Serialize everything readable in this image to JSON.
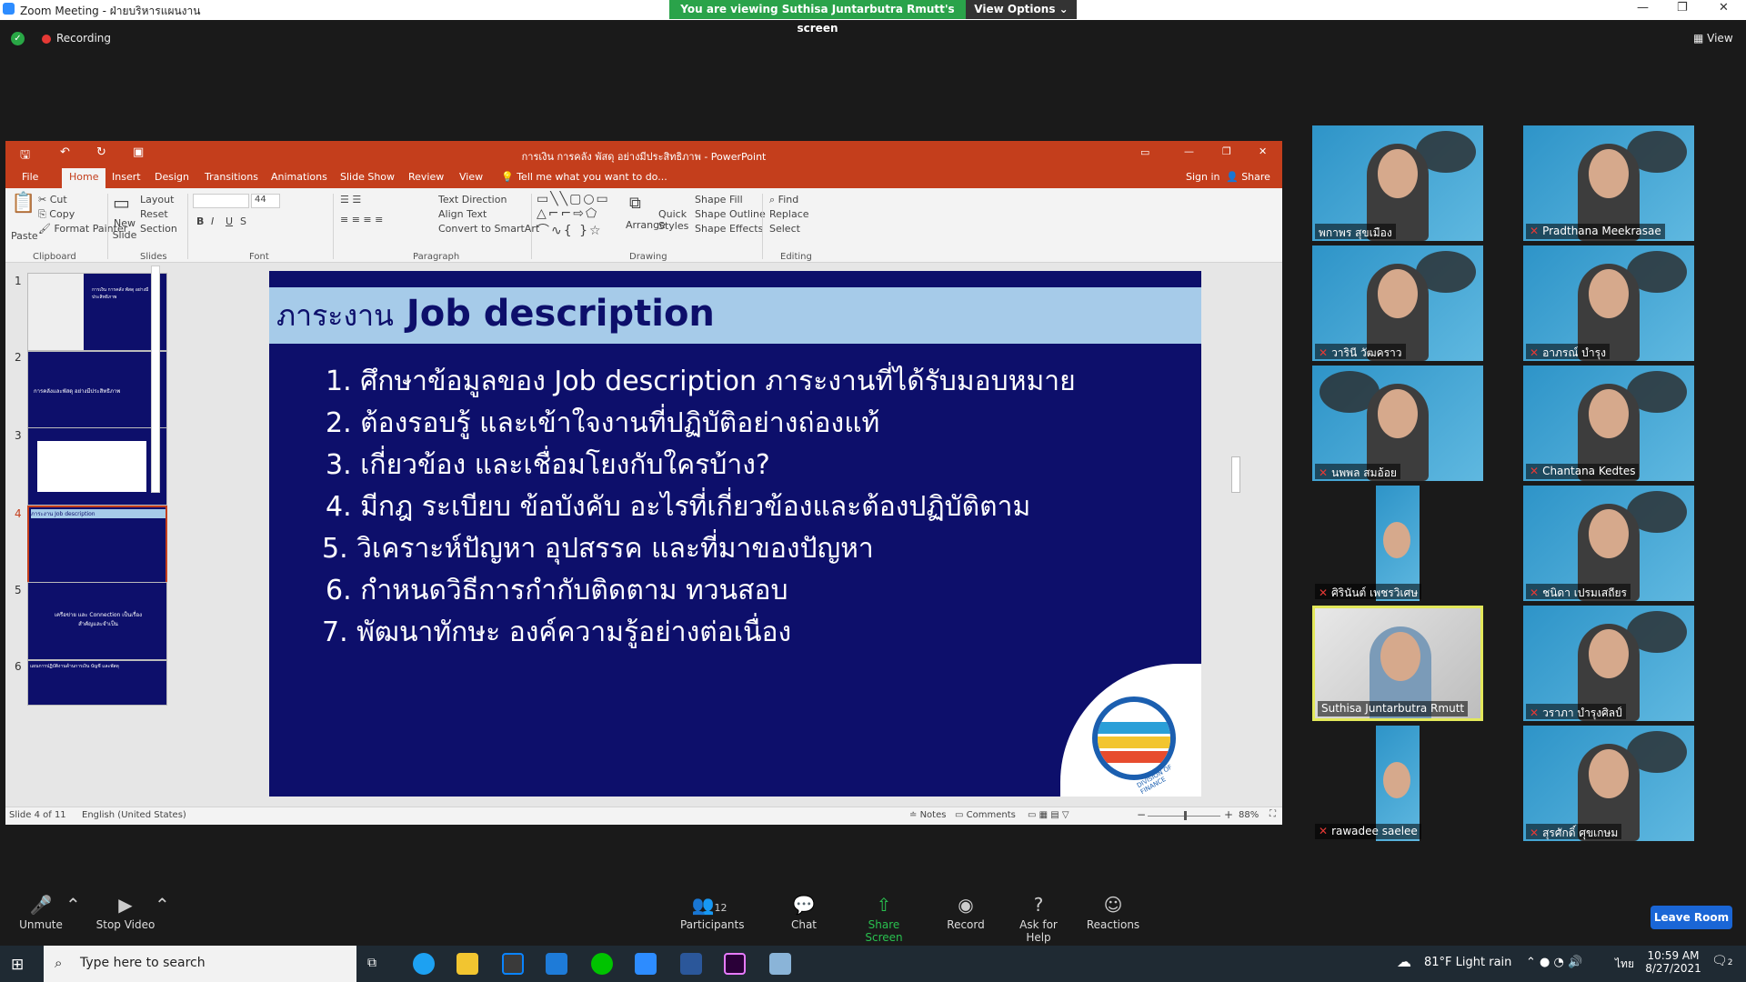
{
  "zoom": {
    "window_title": "Zoom Meeting - ฝ่ายบริหารแผนงาน",
    "viewing_banner": "You are viewing Suthisa  Juntarbutra Rmutt's screen",
    "view_options": "View Options",
    "recording_label": "Recording",
    "view_label": "View"
  },
  "powerpoint": {
    "title": "การเงิน การคลัง พัสดุ อย่างมีประสิทธิภาพ - PowerPoint",
    "tabs": [
      "File",
      "Home",
      "Insert",
      "Design",
      "Transitions",
      "Animations",
      "Slide Show",
      "Review",
      "View"
    ],
    "tell_me": "Tell me what you want to do...",
    "sign_in": "Sign in",
    "share": "Share",
    "ribbon": {
      "clipboard": {
        "paste": "Paste",
        "cut": "Cut",
        "copy": "Copy",
        "format_painter": "Format Painter",
        "group": "Clipboard"
      },
      "slides": {
        "new_slide": "New Slide",
        "layout": "Layout",
        "reset": "Reset",
        "section": "Section",
        "group": "Slides"
      },
      "font": {
        "size": "44",
        "group": "Font"
      },
      "paragraph": {
        "text_direction": "Text Direction",
        "align_text": "Align Text",
        "convert": "Convert to SmartArt",
        "group": "Paragraph"
      },
      "drawing": {
        "arrange": "Arrange",
        "quick_styles": "Quick Styles",
        "shape_fill": "Shape Fill",
        "shape_outline": "Shape Outline",
        "shape_effects": "Shape Effects",
        "group": "Drawing"
      },
      "editing": {
        "find": "Find",
        "replace": "Replace",
        "select": "Select",
        "group": "Editing"
      }
    },
    "thumbnails": [
      {
        "num": "1",
        "caption": "การเงิน การคลัง พัสดุ อย่างมีประสิทธิภาพ"
      },
      {
        "num": "2",
        "caption": "การคลังและพัสดุ อย่างมีประสิทธิภาพ"
      },
      {
        "num": "3",
        "caption": ""
      },
      {
        "num": "4",
        "caption": "ภาระงาน Job description"
      },
      {
        "num": "5",
        "caption": "เครือข่าย และ Connection เป็นเรื่องสำคัญและจำเป็น"
      },
      {
        "num": "6",
        "caption": "แผนการปฏิบัติงานด้านการเงิน บัญชี และพัสดุ"
      }
    ],
    "slide": {
      "title_thai": "ภาระงาน",
      "title_en": "Job description",
      "items": [
        "1. ศึกษาข้อมูลของ Job description ภาระงานที่ได้รับมอบหมาย",
        "2. ต้องรอบรู้ และเข้าใจงานที่ปฏิบัติอย่างถ่องแท้",
        "3. เกี่ยวข้อง และเชื่อมโยงกับใครบ้าง?",
        "4. มีกฎ ระเบียบ ข้อบังคับ อะไรที่เกี่ยวข้องและต้องปฏิบัติตาม",
        "5. วิเคราะห์ปัญหา อุปสรรค และที่มาของปัญหา",
        "6. กำหนดวิธีการกำกับติดตาม ทวนสอบ",
        "7. พัฒนาทักษะ องค์ความรู้อย่างต่อเนื่อง"
      ],
      "logo_text": "DIVISION OF FINANCE"
    },
    "status": {
      "slide_of": "Slide 4 of 11",
      "language": "English (United States)",
      "notes": "Notes",
      "comments": "Comments",
      "zoom": "88%"
    }
  },
  "participants": [
    {
      "name": "พกาพร สุขเมือง",
      "muted": false
    },
    {
      "name": "Pradthana Meekrasae",
      "muted": true
    },
    {
      "name": "วารินี วัฒคราว",
      "muted": true
    },
    {
      "name": "อาภรณ์ บำรุง",
      "muted": true
    },
    {
      "name": "นพพล สมอ้อย",
      "muted": true
    },
    {
      "name": "Chantana Kedtes",
      "muted": true
    },
    {
      "name": "ศิรินันต์ เพชรวิเศษ",
      "muted": true
    },
    {
      "name": "ชนิดา เปรมเสถียร",
      "muted": true
    },
    {
      "name": "Suthisa  Juntarbutra Rmutt",
      "muted": false
    },
    {
      "name": "วราภา บำรุงศิลป์",
      "muted": true
    },
    {
      "name": "rawadee saelee",
      "muted": true
    },
    {
      "name": "สุรศักดิ์ ศุขเกษม",
      "muted": true
    }
  ],
  "toolbar": {
    "unmute": "Unmute",
    "stop_video": "Stop Video",
    "participants": "Participants",
    "participants_count": "12",
    "chat": "Chat",
    "share_screen": "Share Screen",
    "record": "Record",
    "ask_help": "Ask for Help",
    "reactions": "Reactions",
    "leave": "Leave Room"
  },
  "taskbar": {
    "search_placeholder": "Type here to search",
    "weather": "81°F  Light rain",
    "lang": "ไทย",
    "time": "10:59 AM",
    "date": "8/27/2021",
    "notif_count": "2"
  }
}
